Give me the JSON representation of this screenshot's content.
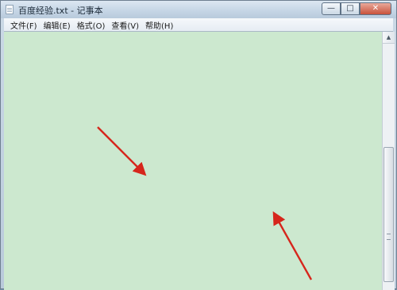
{
  "window": {
    "title": "百度经验.txt - 记事本",
    "minimize_icon": "minimize-icon",
    "maximize_icon": "maximize-icon",
    "close_icon": "close-icon"
  },
  "menubar": {
    "items": [
      {
        "label": "文件(F)"
      },
      {
        "label": "编辑(E)"
      },
      {
        "label": "格式(O)"
      },
      {
        "label": "查看(V)"
      },
      {
        "label": "帮助(H)"
      }
    ]
  },
  "editor": {
    "background_color": "#cce8cf"
  },
  "annotations": {
    "arrow_color": "#d6261c"
  }
}
